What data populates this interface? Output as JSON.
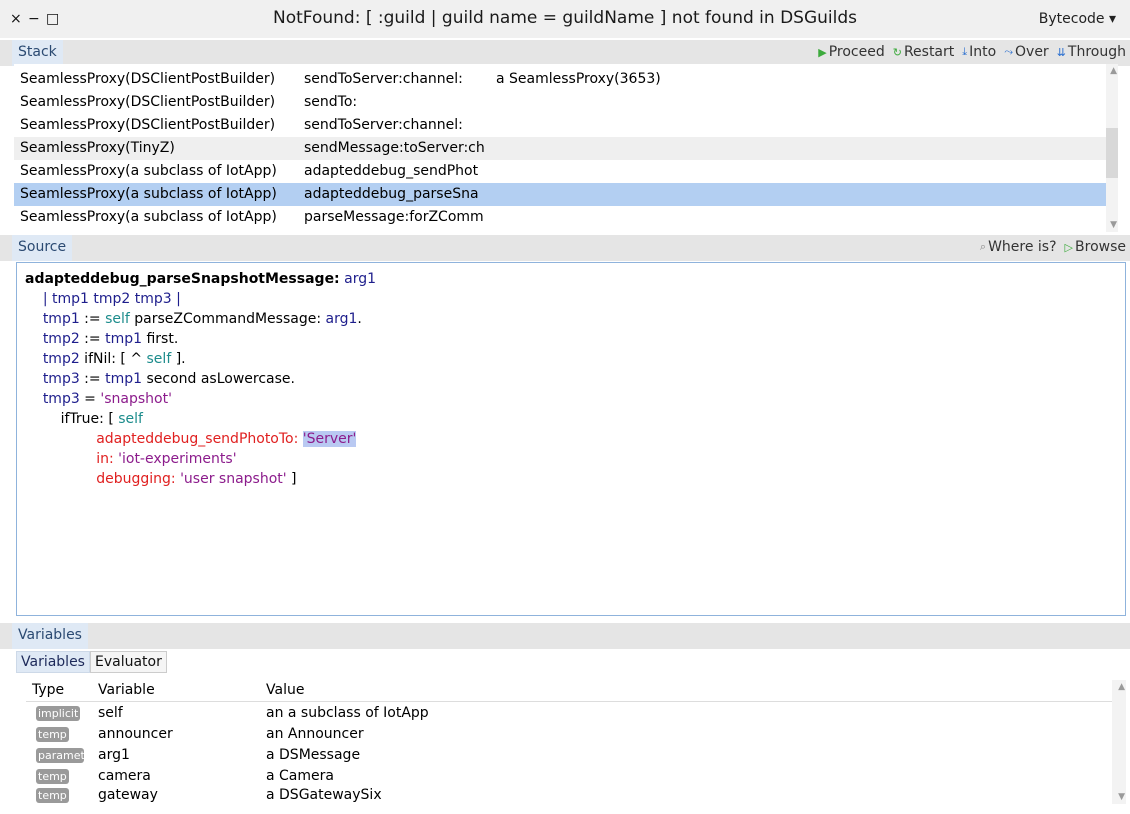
{
  "window": {
    "title": "NotFound: [ :guild | guild name = guildName ] not found in DSGuilds",
    "controls": [
      "×",
      "−",
      "□"
    ],
    "mode_label": "Bytecode",
    "mode_icon": "dropdown-icon"
  },
  "stack": {
    "header": "Stack",
    "toolbar": {
      "proceed": "Proceed",
      "restart": "Restart",
      "into": "Into",
      "over": "Over",
      "through": "Through"
    },
    "rows": [
      {
        "receiver": "SeamlessProxy(DSClientPostBuilder)",
        "method": "sendToServer:channel:",
        "extra": "a SeamlessProxy(3653)"
      },
      {
        "receiver": "SeamlessProxy(DSClientPostBuilder)",
        "method": "sendTo:",
        "extra": ""
      },
      {
        "receiver": "SeamlessProxy(DSClientPostBuilder)",
        "method": "sendToServer:channel:",
        "extra": ""
      },
      {
        "receiver": "SeamlessProxy(TinyZ)",
        "method": "sendMessage:toServer:ch",
        "extra": ""
      },
      {
        "receiver": "SeamlessProxy(a subclass of IotApp)",
        "method": "adapteddebug_sendPhot",
        "extra": ""
      },
      {
        "receiver": "SeamlessProxy(a subclass of IotApp)",
        "method": "adapteddebug_parseSna",
        "extra": ""
      },
      {
        "receiver": "SeamlessProxy(a subclass of IotApp)",
        "method": "parseMessage:forZComm",
        "extra": ""
      }
    ]
  },
  "source": {
    "header": "Source",
    "where_is": "Where is?",
    "browse": "Browse",
    "lines": {
      "l1_sel": "adapteddebug_parseSnapshotMessage:",
      "l1_arg": "arg1",
      "l2": "| tmp1 tmp2 tmp3 |",
      "l3_a": "tmp1",
      "l3_b": " := ",
      "l3_c": "self",
      "l3_d": " parseZCommandMessage: ",
      "l3_e": "arg1",
      "l3_f": ".",
      "l4_a": "tmp2",
      "l4_b": " := ",
      "l4_c": "tmp1",
      "l4_d": " first.",
      "l5_a": "tmp2",
      "l5_b": " ifNil: [ ^ ",
      "l5_c": "self",
      "l5_d": " ].",
      "l6_a": "tmp3",
      "l6_b": " := ",
      "l6_c": "tmp1",
      "l6_d": " second asLowercase.",
      "l7_a": "tmp3",
      "l7_b": " = ",
      "l7_c": "'snapshot'",
      "l8_a": "ifTrue: [ ",
      "l8_b": "self",
      "l9_a": "adapteddebug_sendPhotoTo: ",
      "l9_b": "'Server'",
      "l10_a": "in: ",
      "l10_b": "'iot-experiments'",
      "l11_a": "debugging: ",
      "l11_b": "'user snapshot'",
      "l11_c": " ]"
    }
  },
  "variables": {
    "header": "Variables",
    "tabs": [
      "Variables",
      "Evaluator"
    ],
    "columns": [
      "Type",
      "Variable",
      "Value"
    ],
    "rows": [
      {
        "type": "implicit",
        "name": "self",
        "value": "an a subclass of IotApp"
      },
      {
        "type": "temp",
        "name": "announcer",
        "value": "an Announcer"
      },
      {
        "type": "parameter",
        "name": "arg1",
        "value": "a DSMessage"
      },
      {
        "type": "temp",
        "name": "camera",
        "value": "a Camera"
      },
      {
        "type": "temp",
        "name": "gateway",
        "value": "a DSGatewaySix"
      }
    ]
  },
  "colors": {
    "accent_tab": "#dfe9f5",
    "selection": "#b3cff2",
    "proceed_green": "#3caa3c",
    "into_blue": "#2a6fcf"
  }
}
